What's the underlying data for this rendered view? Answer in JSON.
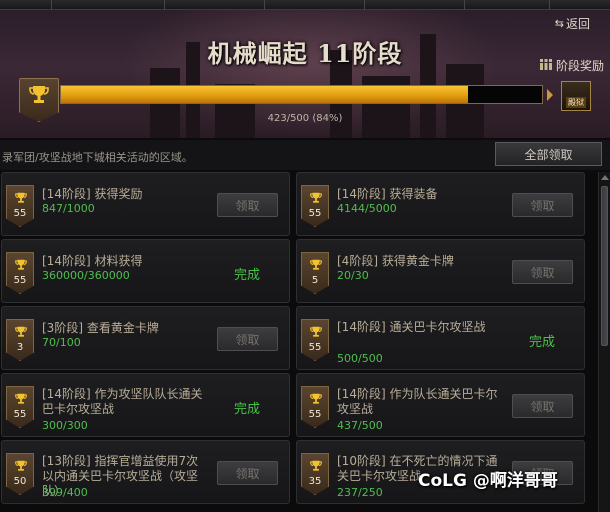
{
  "header": {
    "title": "机械崛起 11阶段",
    "return_label": "返回",
    "stage_reward_label": "阶段奖励",
    "progress_text": "423/500 (84%)",
    "progress_fraction": 0.846,
    "reward_box_label": "殿狱"
  },
  "info": {
    "text": "录军团/攻坚战地下城相关活动的区域。",
    "claim_all_label": "全部领取"
  },
  "cards": [
    {
      "title": "[14阶段] 获得奖励",
      "progress": "847/1000",
      "level": "55",
      "action": "领取",
      "state": "button"
    },
    {
      "title": "[14阶段] 获得装备",
      "progress": "4144/5000",
      "level": "55",
      "action": "领取",
      "state": "button"
    },
    {
      "title": "[14阶段] 材料获得",
      "progress": "360000/360000",
      "level": "55",
      "action": "完成",
      "state": "done"
    },
    {
      "title": "[4阶段] 获得黄金卡牌",
      "progress": "20/30",
      "level": "5",
      "action": "领取",
      "state": "button"
    },
    {
      "title": "[3阶段] 查看黄金卡牌",
      "progress": "70/100",
      "level": "3",
      "action": "领取",
      "state": "button"
    },
    {
      "title": "[14阶段] 通关巴卡尔攻坚战",
      "progress": "500/500",
      "level": "55",
      "action": "完成",
      "state": "done"
    },
    {
      "title": "[14阶段] 作为攻坚队队长通关巴卡尔攻坚战",
      "progress": "300/300",
      "level": "55",
      "action": "完成",
      "state": "done"
    },
    {
      "title": "[14阶段] 作为队长通关巴卡尔攻坚战",
      "progress": "437/500",
      "level": "55",
      "action": "领取",
      "state": "button"
    },
    {
      "title": "[13阶段] 指挥官增益使用7次以内通关巴卡尔攻坚战（攻坚队）",
      "progress": "399/400",
      "level": "50",
      "action": "领取",
      "state": "button"
    },
    {
      "title": "[10阶段] 在不死亡的情况下通关巴卡尔攻坚战",
      "progress": "237/250",
      "level": "35",
      "action": "领取",
      "state": "button"
    }
  ],
  "watermark": "CoLG @啊洋哥哥",
  "colors": {
    "progress_fill": "#e9a91c",
    "complete": "#47c247",
    "progress_text": "#4fbe4f"
  }
}
